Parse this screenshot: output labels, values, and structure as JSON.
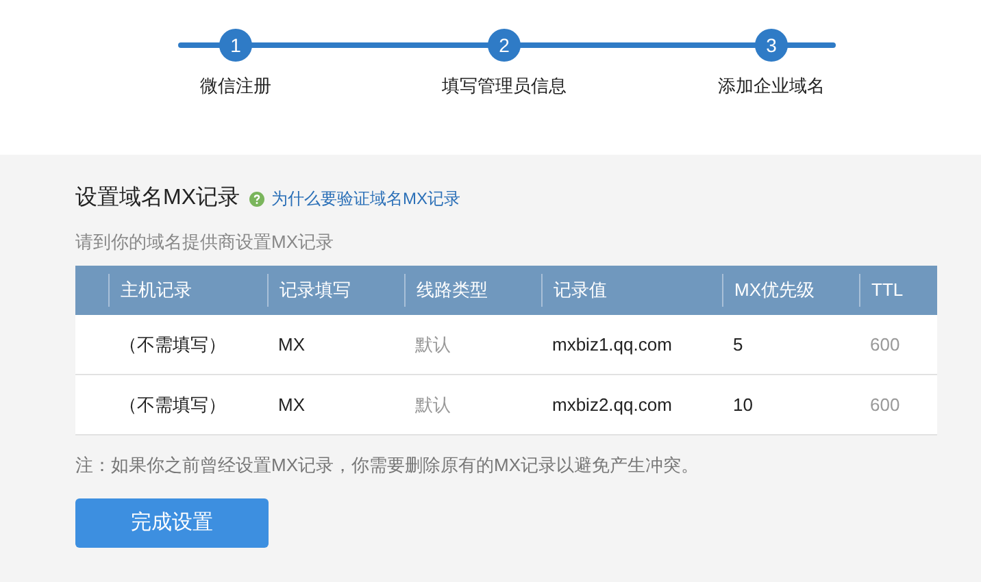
{
  "steps": [
    {
      "number": "1",
      "label": "微信注册"
    },
    {
      "number": "2",
      "label": "填写管理员信息"
    },
    {
      "number": "3",
      "label": "添加企业域名"
    }
  ],
  "section": {
    "title": "设置域名MX记录",
    "help_link": "为什么要验证域名MX记录",
    "subtitle": "请到你的域名提供商设置MX记录"
  },
  "table": {
    "columns": [
      {
        "label": "主机记录",
        "muted": false
      },
      {
        "label": "记录填写",
        "muted": false
      },
      {
        "label": "线路类型",
        "muted": true
      },
      {
        "label": "记录值",
        "muted": false
      },
      {
        "label": "MX优先级",
        "muted": false
      },
      {
        "label": "TTL",
        "muted": true
      }
    ],
    "rows": [
      [
        "（不需填写）",
        "MX",
        "默认",
        "mxbiz1.qq.com",
        "5",
        "600"
      ],
      [
        "（不需填写）",
        "MX",
        "默认",
        "mxbiz2.qq.com",
        "10",
        "600"
      ]
    ]
  },
  "note": "注：如果你之前曾经设置MX记录，你需要删除原有的MX记录以避免产生冲突。",
  "button": "完成设置"
}
